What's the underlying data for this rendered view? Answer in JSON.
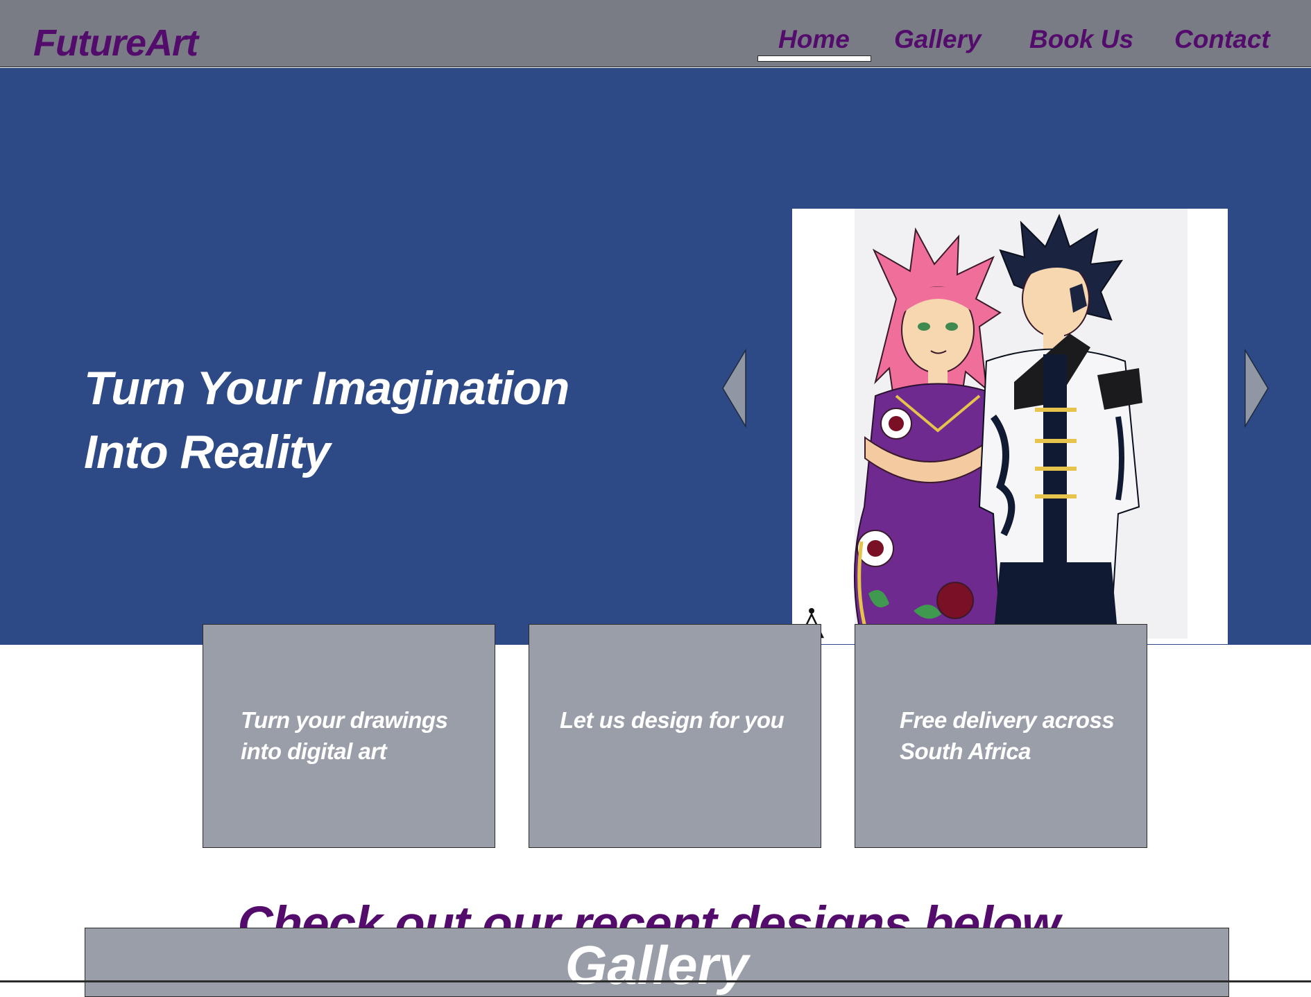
{
  "brand": {
    "name": "FutureArt",
    "color": "#530c6c"
  },
  "nav": {
    "items": [
      {
        "label": "Home",
        "active": true
      },
      {
        "label": "Gallery",
        "active": false
      },
      {
        "label": "Book Us",
        "active": false
      },
      {
        "label": "Contact",
        "active": false
      }
    ]
  },
  "hero": {
    "title_line1": "Turn Your Imagination",
    "title_line2": "Into Reality",
    "background": "#2e4a86",
    "image_description_icon": "anime-artwork-image",
    "prev_icon": "chevron-left-icon",
    "next_icon": "chevron-right-icon"
  },
  "features": [
    {
      "line1": "Turn your drawings",
      "line2": "into digital art"
    },
    {
      "line1": "Let us design for you",
      "line2": ""
    },
    {
      "line1": "Free delivery across",
      "line2": "South Africa"
    }
  ],
  "recent": {
    "heading": "Check out our recent designs below"
  },
  "gallery": {
    "title": "Gallery"
  },
  "colors": {
    "topbar": "#797c84",
    "card": "#999ea8",
    "accent_text": "#530c6c"
  }
}
